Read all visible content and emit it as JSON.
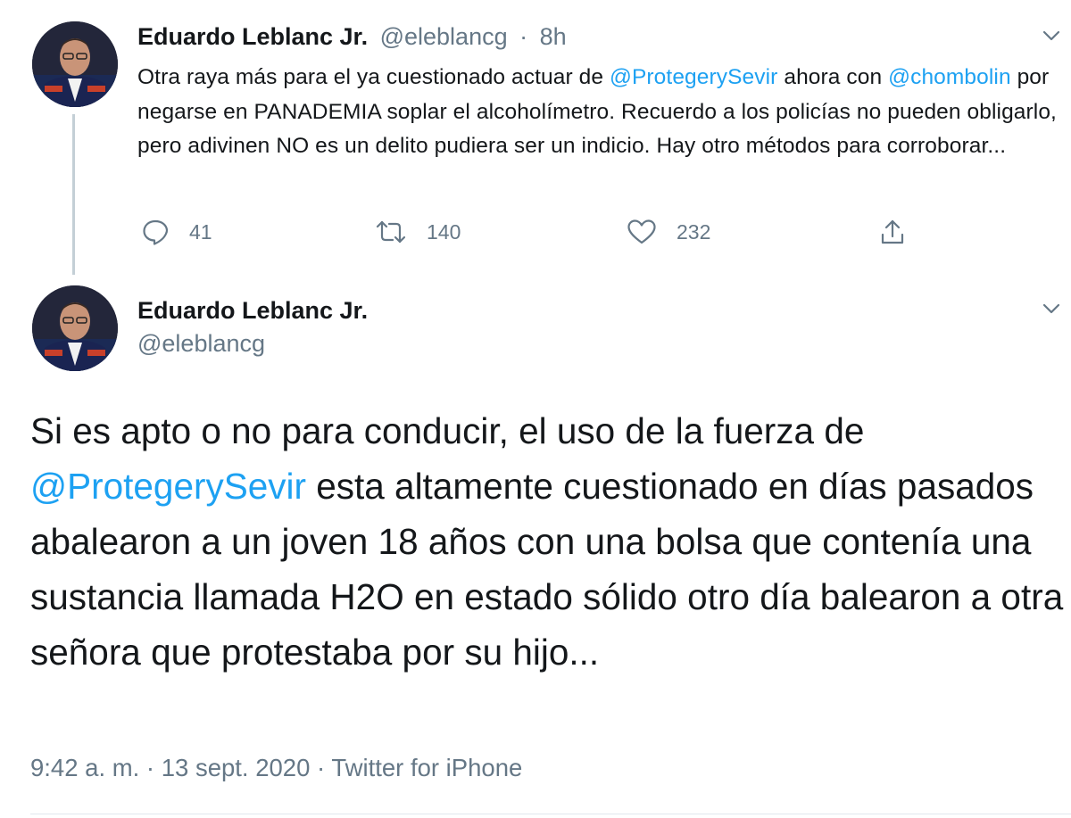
{
  "tweet1": {
    "author_name": "Eduardo Leblanc Jr.",
    "handle": "@eleblancg",
    "separator": "·",
    "time": "8h",
    "text_parts": [
      "Otra raya más para el ya cuestionado actuar de ",
      "@ProtegerySevir",
      " ahora con ",
      "@chombolin",
      " por negarse en PANADEMIA soplar el alcoholímetro. Recuerdo a los policías no pueden obligarlo, pero adivinen NO es un delito pudiera ser un indicio. Hay otro métodos para corroborar..."
    ],
    "stats": {
      "replies": "41",
      "retweets": "140",
      "likes": "232"
    }
  },
  "tweet2": {
    "author_name": "Eduardo Leblanc Jr.",
    "handle": "@eleblancg",
    "text_parts": [
      "Si es apto o no para conducir, el uso de la fuerza de ",
      "@ProtegerySevir",
      " esta altamente cuestionado en días pasados abalearon a un joven 18 años con una bolsa que contenía una sustancia llamada H2O en estado sólido otro día balearon a otra señora que protestaba por su hijo..."
    ],
    "timestamp": "9:42 a. m. · 13 sept. 2020 · Twitter for iPhone"
  },
  "icons": {
    "reply": "comment-bubble-icon",
    "retweet": "retweet-icon",
    "like": "heart-icon",
    "share": "share-upload-icon",
    "more": "chevron-down-icon"
  },
  "colors": {
    "mention": "#1da1f2",
    "secondary_text": "#657786",
    "thread_line": "#c4cfd6"
  }
}
